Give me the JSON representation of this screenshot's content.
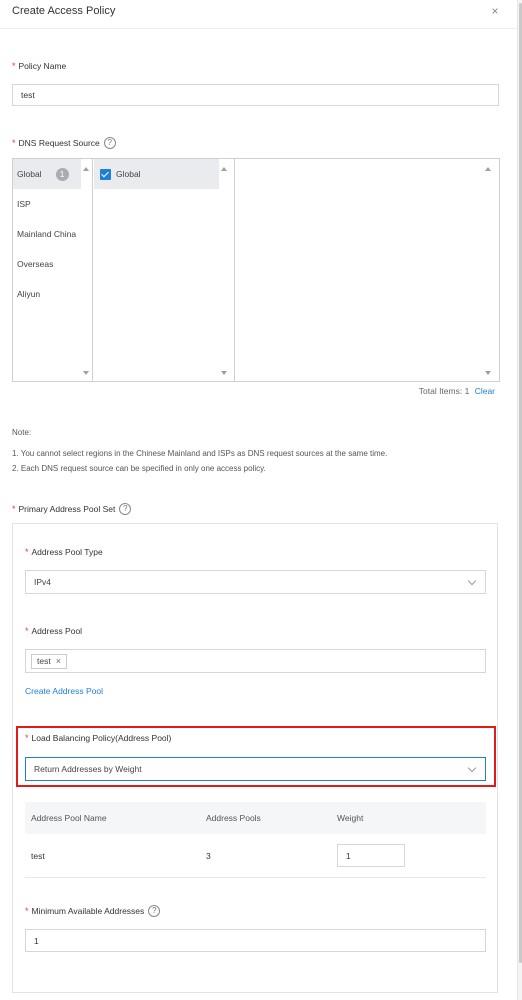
{
  "dialog": {
    "title": "Create Access Policy",
    "close_icon": "close-icon"
  },
  "policy_name": {
    "label": "Policy Name",
    "required_mark": "*",
    "value": "test"
  },
  "dns_source": {
    "label": "DNS Request Source",
    "help_icon": "?",
    "categories": [
      {
        "label": "Global",
        "badge": "1"
      },
      {
        "label": "ISP"
      },
      {
        "label": "Mainland China"
      },
      {
        "label": "Overseas"
      },
      {
        "label": "Aliyun"
      }
    ],
    "options": [
      {
        "label": "Global",
        "checked": true
      }
    ],
    "total_label": "Total Items: 1",
    "clear_label": "Clear"
  },
  "notes": {
    "heading": "Note:",
    "line1": "1. You cannot select regions in the Chinese Mainland and ISPs as DNS request sources at the same time.",
    "line2": "2. Each DNS request source can be specified in only one access policy."
  },
  "primary_pool": {
    "label": "Primary Address Pool Set",
    "help_icon": "?",
    "pool_type_label": "Address Pool Type",
    "pool_type_value": "IPv4",
    "address_pool_label": "Address Pool",
    "address_pool_tag": "test",
    "tag_remove": "×",
    "create_link": "Create Address Pool",
    "lb_policy_label": "Load Balancing Policy(Address Pool)",
    "lb_policy_value": "Return Addresses by Weight",
    "table": {
      "headers": [
        "Address Pool Name",
        "Address Pools",
        "Weight"
      ],
      "rows": [
        {
          "name": "test",
          "pools": "3",
          "weight": "1"
        }
      ]
    },
    "min_addresses_label": "Minimum Available Addresses",
    "min_addresses_help": "?",
    "min_addresses_value": "1"
  },
  "colors": {
    "accent": "#1f7ed6",
    "required": "#e03a3a",
    "highlight": "#e01b1b"
  }
}
